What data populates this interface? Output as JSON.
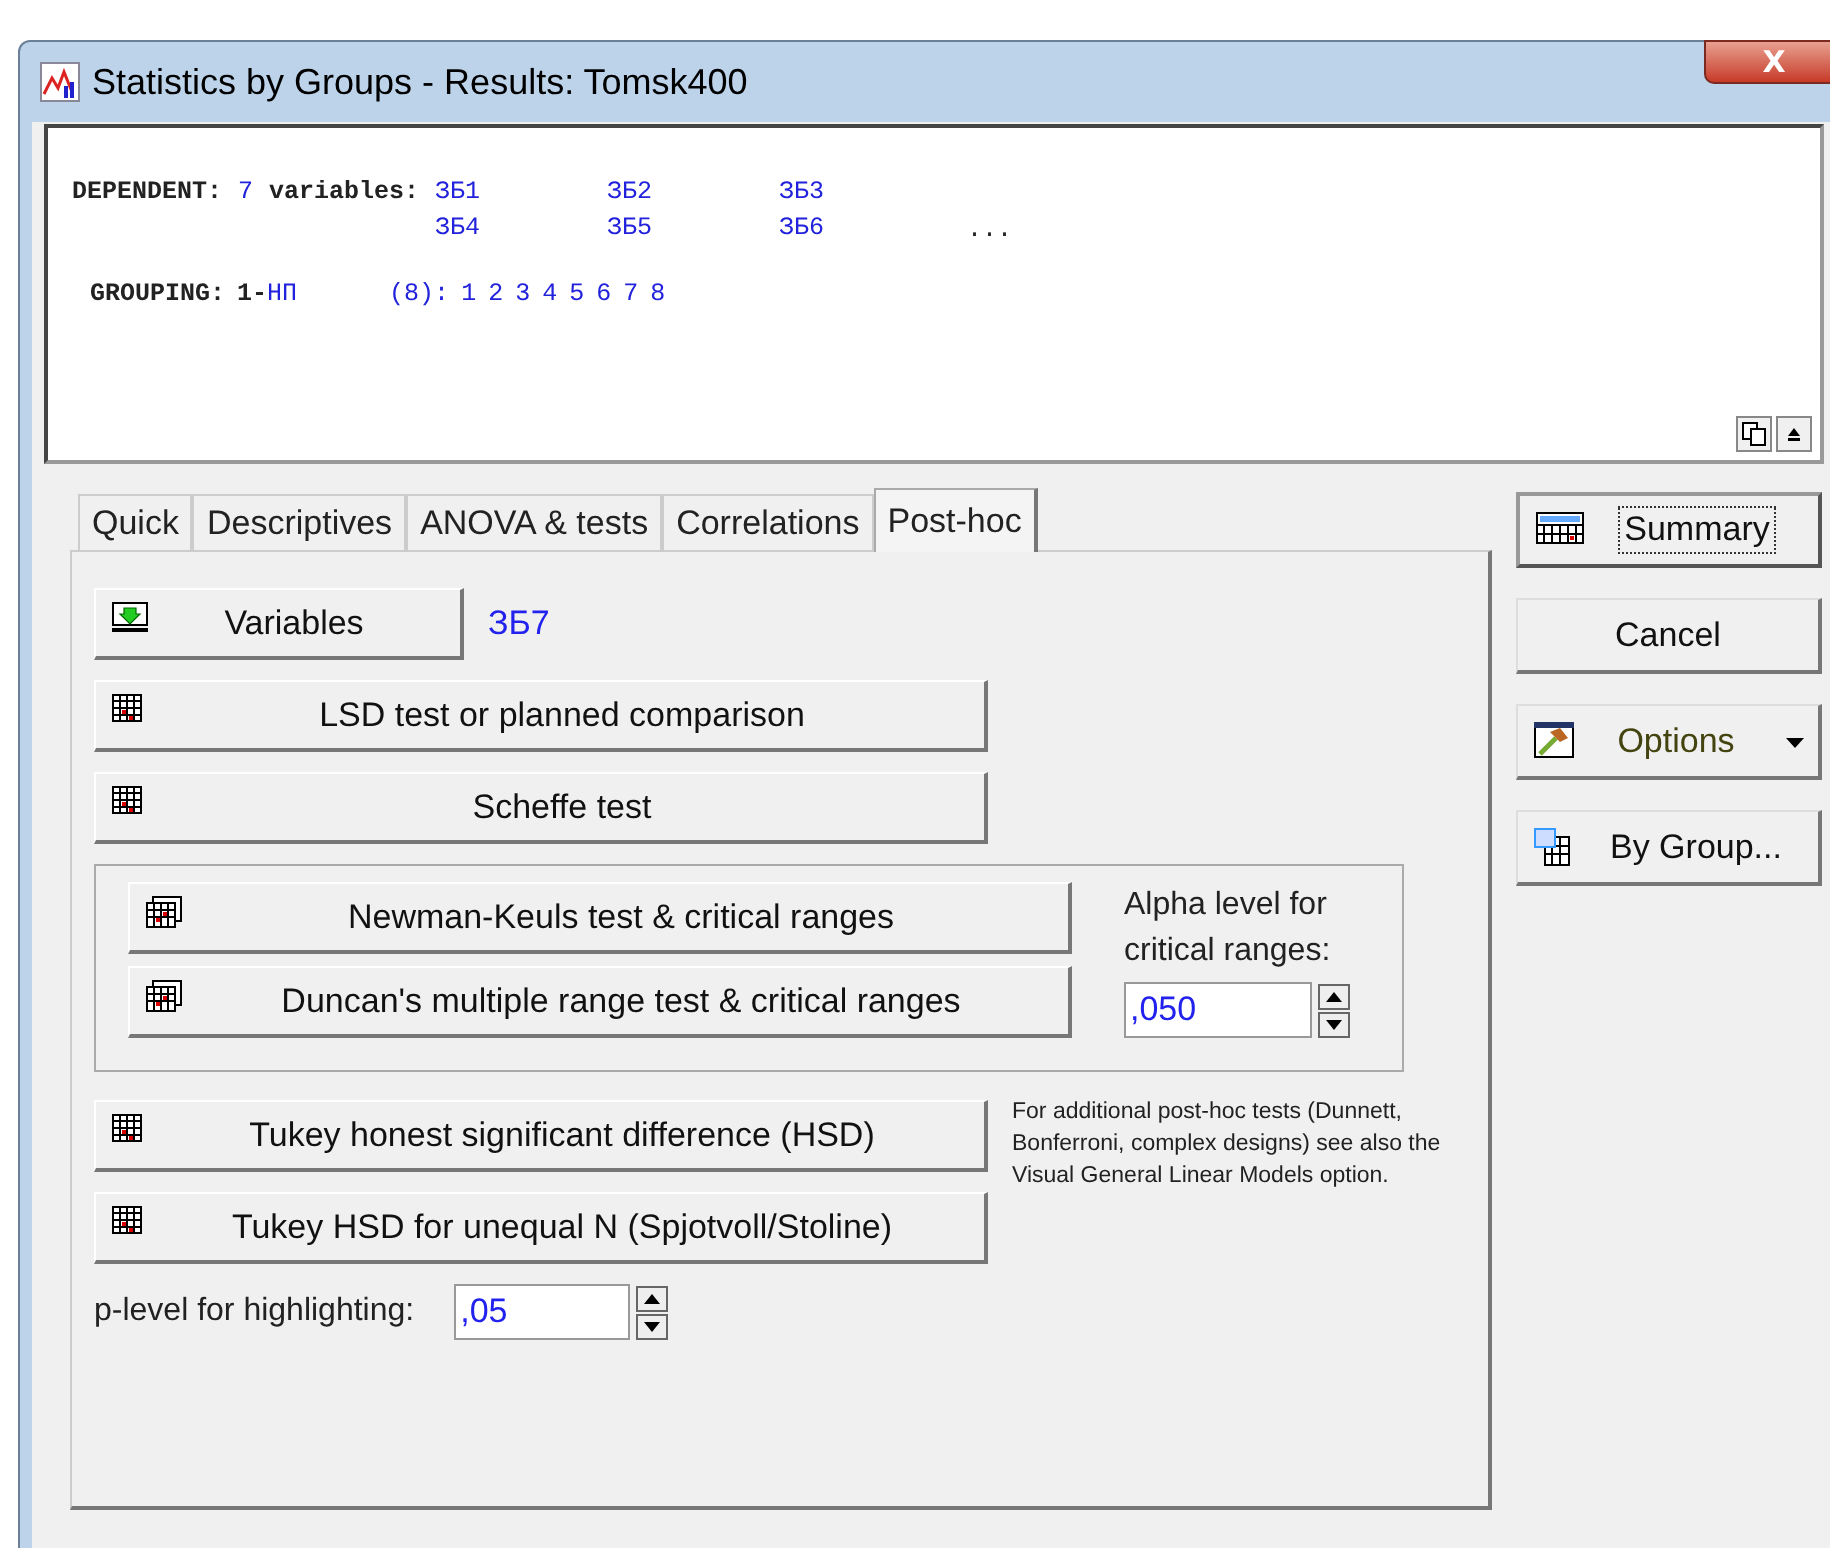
{
  "window": {
    "title": "Statistics by Groups - Results: Tomsk400",
    "close": "X"
  },
  "output": {
    "dependent_label": "DEPENDENT:",
    "dependent_count": "7",
    "dependent_word": "variables:",
    "variables": [
      "ЗБ1",
      "ЗБ2",
      "ЗБ3",
      "ЗБ4",
      "ЗБ5",
      "ЗБ6"
    ],
    "more": "...",
    "grouping_label": "GROUPING:",
    "grouping_prefix": "1-",
    "grouping_var": "НП",
    "grouping_count": "(8):",
    "codes": [
      "1",
      "2",
      "3",
      "4",
      "5",
      "6",
      "7",
      "8"
    ]
  },
  "tabs": [
    {
      "label": "Quick",
      "selected": false
    },
    {
      "label": "Descriptives",
      "selected": false
    },
    {
      "label": "ANOVA & tests",
      "selected": false
    },
    {
      "label": "Correlations",
      "selected": false
    },
    {
      "label": "Post-hoc",
      "selected": true
    }
  ],
  "variables_button": {
    "label": "Variables",
    "value": "ЗБ7"
  },
  "top_buttons": [
    "LSD test or planned comparison",
    "Scheffe test"
  ],
  "range_group": {
    "buttons": [
      "Newman-Keuls test & critical ranges",
      "Duncan's multiple range test & critical ranges"
    ],
    "alpha_label": "Alpha level for critical ranges:",
    "alpha_value": ",050"
  },
  "tukey_buttons": [
    "Tukey honest significant difference (HSD)",
    "Tukey HSD for unequal N (Spjotvoll/Stoline)"
  ],
  "note": "For additional post-hoc tests (Dunnett, Bonferroni, complex designs) see also the Visual General Linear Models option.",
  "plevel": {
    "label": "p-level for highlighting:",
    "value": ",05"
  },
  "side_buttons": [
    {
      "label": "Summary",
      "kind": "summary",
      "focused": true
    },
    {
      "label": "Cancel",
      "kind": "plain",
      "focused": false
    },
    {
      "label": "Options",
      "kind": "options",
      "focused": false
    },
    {
      "label": "By Group...",
      "kind": "bygroup",
      "focused": false
    }
  ]
}
